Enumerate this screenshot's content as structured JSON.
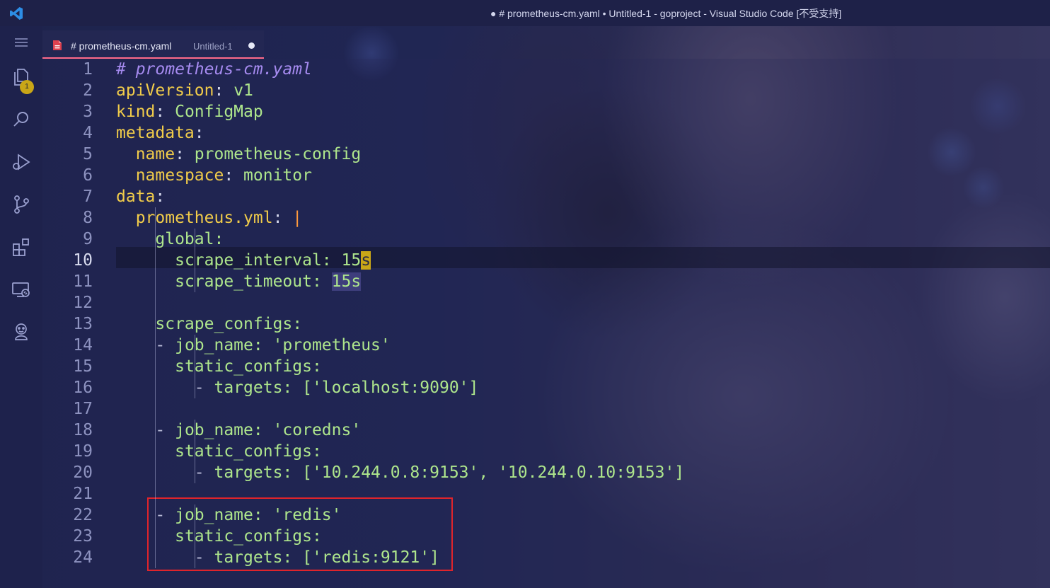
{
  "window": {
    "title": "● # prometheus-cm.yaml • Untitled-1 - goproject - Visual Studio Code [不受支持]"
  },
  "activity_bar": {
    "items": [
      {
        "name": "explorer",
        "icon": "files-icon"
      },
      {
        "name": "search",
        "icon": "search-icon"
      },
      {
        "name": "run-debug",
        "icon": "debug-icon"
      },
      {
        "name": "source-control",
        "icon": "git-branch-icon"
      },
      {
        "name": "extensions",
        "icon": "extensions-icon"
      },
      {
        "name": "remote-explorer",
        "icon": "remote-icon"
      },
      {
        "name": "account",
        "icon": "jenkins-icon"
      }
    ],
    "explorer_badge": "1"
  },
  "tab": {
    "filename": "# prometheus-cm.yaml",
    "description": "Untitled-1",
    "dirty": true
  },
  "editor": {
    "active_line": 10,
    "lines": [
      {
        "n": "1",
        "tokens": [
          [
            "comment",
            "# prometheus-cm.yaml"
          ]
        ]
      },
      {
        "n": "2",
        "tokens": [
          [
            "key",
            "apiVersion"
          ],
          [
            "punct",
            ": "
          ],
          [
            "value",
            "v1"
          ]
        ]
      },
      {
        "n": "3",
        "tokens": [
          [
            "key",
            "kind"
          ],
          [
            "punct",
            ": "
          ],
          [
            "value",
            "ConfigMap"
          ]
        ]
      },
      {
        "n": "4",
        "tokens": [
          [
            "key",
            "metadata"
          ],
          [
            "punct",
            ":"
          ]
        ]
      },
      {
        "n": "5",
        "tokens": [
          [
            "ws",
            "  "
          ],
          [
            "key",
            "name"
          ],
          [
            "punct",
            ": "
          ],
          [
            "value",
            "prometheus-config"
          ]
        ]
      },
      {
        "n": "6",
        "tokens": [
          [
            "ws",
            "  "
          ],
          [
            "key",
            "namespace"
          ],
          [
            "punct",
            ": "
          ],
          [
            "value",
            "monitor"
          ]
        ]
      },
      {
        "n": "7",
        "tokens": [
          [
            "key",
            "data"
          ],
          [
            "punct",
            ":"
          ]
        ]
      },
      {
        "n": "8",
        "tokens": [
          [
            "ws",
            "  "
          ],
          [
            "key",
            "prometheus.yml"
          ],
          [
            "punct",
            ": "
          ],
          [
            "pipe",
            "|"
          ]
        ]
      },
      {
        "n": "9",
        "tokens": [
          [
            "ws",
            "    "
          ],
          [
            "key2",
            "global:"
          ]
        ]
      },
      {
        "n": "10",
        "tokens": [
          [
            "ws",
            "      "
          ],
          [
            "key2",
            "scrape_interval: 15"
          ],
          [
            "cursor",
            "s"
          ]
        ]
      },
      {
        "n": "11",
        "tokens": [
          [
            "ws",
            "      "
          ],
          [
            "key2",
            "scrape_timeout: "
          ],
          [
            "match",
            "15s"
          ]
        ]
      },
      {
        "n": "12",
        "tokens": []
      },
      {
        "n": "13",
        "tokens": [
          [
            "ws",
            "    "
          ],
          [
            "key2",
            "scrape_configs:"
          ]
        ]
      },
      {
        "n": "14",
        "tokens": [
          [
            "ws",
            "    "
          ],
          [
            "dash",
            "- "
          ],
          [
            "key2",
            "job_name: 'prometheus'"
          ]
        ]
      },
      {
        "n": "15",
        "tokens": [
          [
            "ws",
            "      "
          ],
          [
            "key2",
            "static_configs:"
          ]
        ]
      },
      {
        "n": "16",
        "tokens": [
          [
            "ws",
            "        "
          ],
          [
            "dash",
            "- "
          ],
          [
            "key2",
            "targets: ['localhost:9090']"
          ]
        ]
      },
      {
        "n": "17",
        "tokens": []
      },
      {
        "n": "18",
        "tokens": [
          [
            "ws",
            "    "
          ],
          [
            "dash",
            "- "
          ],
          [
            "key2",
            "job_name: 'coredns'"
          ]
        ]
      },
      {
        "n": "19",
        "tokens": [
          [
            "ws",
            "      "
          ],
          [
            "key2",
            "static_configs:"
          ]
        ]
      },
      {
        "n": "20",
        "tokens": [
          [
            "ws",
            "        "
          ],
          [
            "dash",
            "- "
          ],
          [
            "key2",
            "targets: ['10.244.0.8:9153', '10.244.0.10:9153']"
          ]
        ]
      },
      {
        "n": "21",
        "tokens": []
      },
      {
        "n": "22",
        "tokens": [
          [
            "ws",
            "    "
          ],
          [
            "dash",
            "- "
          ],
          [
            "key2",
            "job_name: 'redis'"
          ]
        ]
      },
      {
        "n": "23",
        "tokens": [
          [
            "ws",
            "      "
          ],
          [
            "key2",
            "static_configs:"
          ]
        ]
      },
      {
        "n": "24",
        "tokens": [
          [
            "ws",
            "        "
          ],
          [
            "dash",
            "- "
          ],
          [
            "key2",
            "targets: ['redis:9121']"
          ]
        ]
      }
    ]
  },
  "annotation": {
    "color": "#e0242b"
  },
  "colors": {
    "accent_tab": "#ff6a8a",
    "badge": "#c9a617",
    "comment": "#a68bf0",
    "key": "#f1cc4a",
    "value": "#aee68c"
  }
}
